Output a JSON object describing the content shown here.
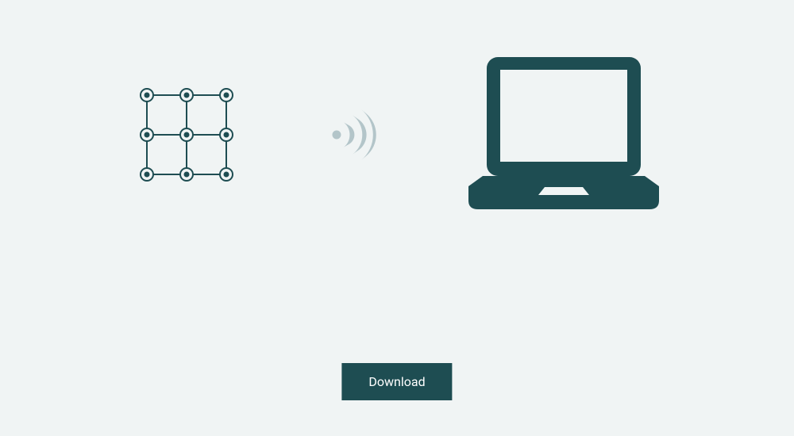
{
  "colors": {
    "primary": "#1e4d52",
    "muted": "#b3c5c9",
    "background": "#f0f4f4"
  },
  "icons": {
    "grid": "grid-network-icon",
    "wifi": "wifi-signal-icon",
    "laptop": "laptop-icon"
  },
  "actions": {
    "download_label": "Download"
  }
}
